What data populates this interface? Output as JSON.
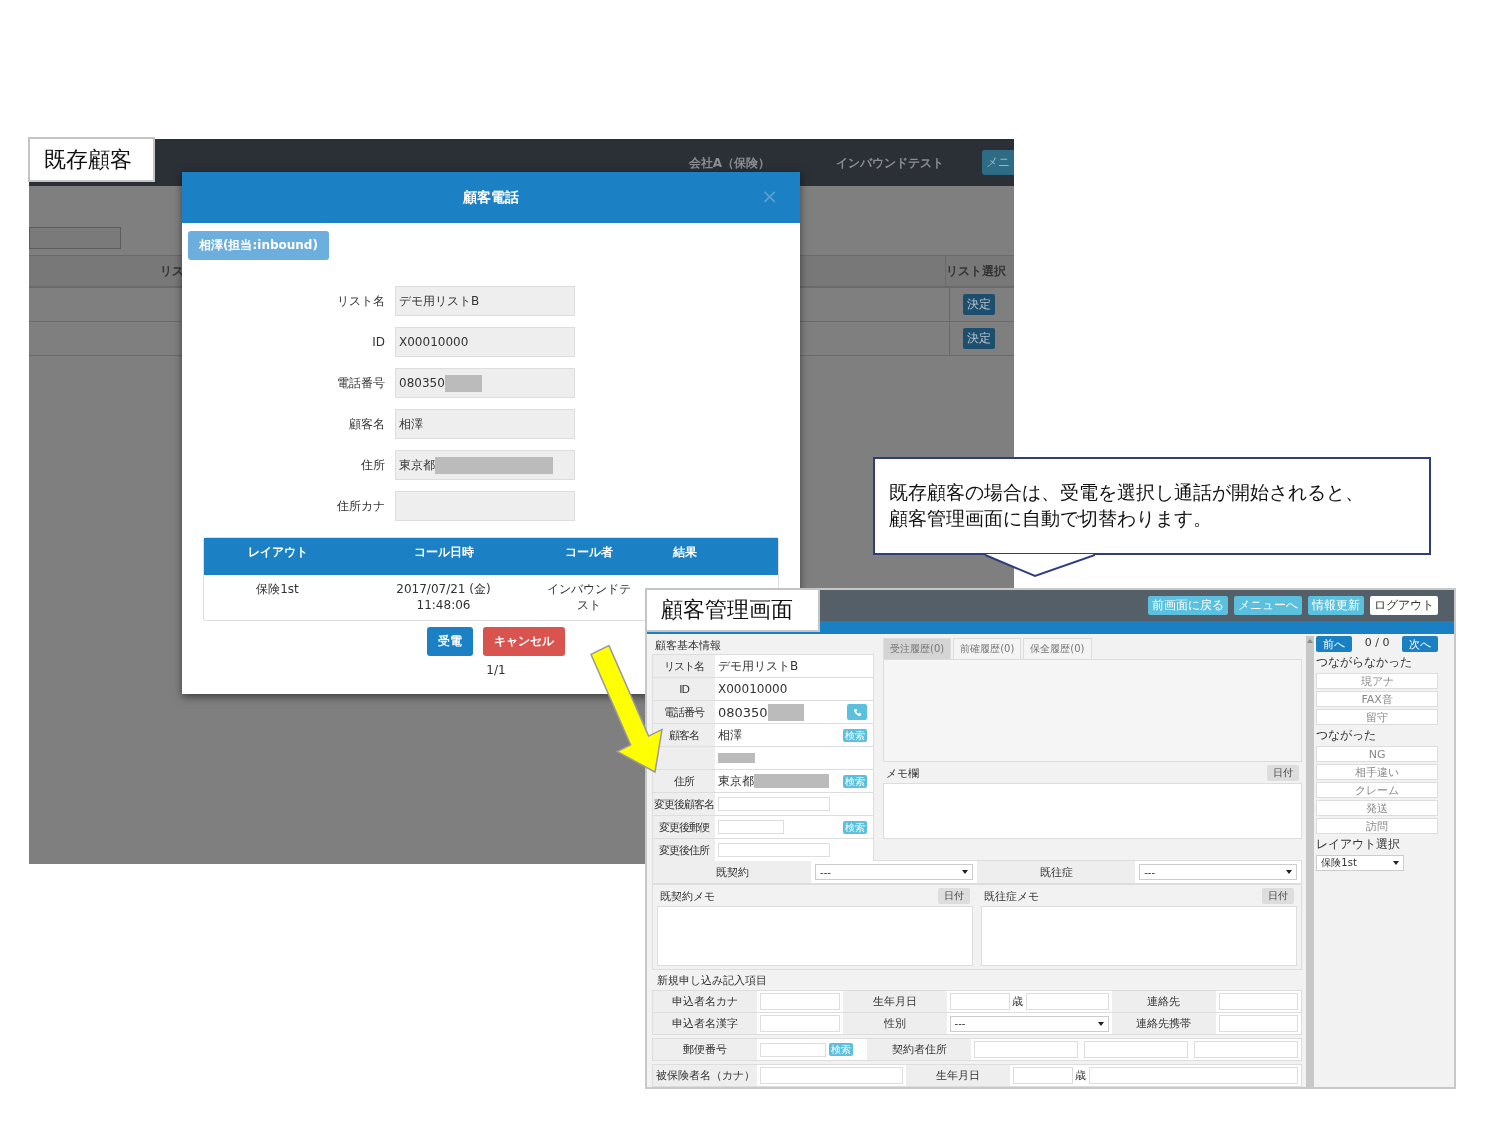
{
  "existing_customer_screen": {
    "caption": "既存顧客",
    "header": {
      "company": "会社A（保険）",
      "campaign": "インバウンドテスト",
      "menu_button": "メニ"
    },
    "list_table": {
      "column_1": "リス",
      "column_2": "リスト選択",
      "rows": [
        {
          "action": "決定"
        },
        {
          "action": "決定"
        }
      ]
    },
    "dialog": {
      "title": "顧客電話",
      "close": "×",
      "customer_badge": "相澤(担当:inbound)",
      "fields": [
        {
          "label": "リスト名",
          "value": "デモ用リストB",
          "masked": false
        },
        {
          "label": "ID",
          "value": "X00010000",
          "masked": false
        },
        {
          "label": "電話番号",
          "value": "080350",
          "masked": true
        },
        {
          "label": "顧客名",
          "value": "相澤",
          "masked": false
        },
        {
          "label": "住所",
          "value": "東京都",
          "masked": true
        },
        {
          "label": "住所カナ",
          "masked": false
        }
      ],
      "history": {
        "columns": [
          "レイアウト",
          "コール日時",
          "コール者",
          "結果"
        ],
        "rows": [
          {
            "layout": "保険1st",
            "call_datetime": "2017/07/21 (金) 11:48:06",
            "caller": "インバウンドテスト"
          }
        ]
      },
      "buttons": [
        {
          "label": "受電",
          "kind": "primary"
        },
        {
          "label": "キャンセル",
          "kind": "danger"
        }
      ],
      "pager": "1/1"
    }
  },
  "callout": {
    "lines": [
      "既存顧客の場合は、受電を選択し通話が開始されると、",
      "顧客管理画面に自動で切替わります。"
    ]
  },
  "customer_management_screen": {
    "caption": "顧客管理画面",
    "header_buttons": [
      {
        "label": "前画面に戻る",
        "kind": "info"
      },
      {
        "label": "メニューへ",
        "kind": "info"
      },
      {
        "label": "情報更新",
        "kind": "info"
      },
      {
        "label": "ログアウト",
        "kind": "light"
      }
    ],
    "basic_info": {
      "title": "顧客基本情報",
      "rows": [
        {
          "label": "リスト名",
          "kind": "text",
          "value": "デモ用リストB",
          "masked": false
        },
        {
          "label": "ID",
          "kind": "text",
          "value": "X00010000",
          "masked": false
        },
        {
          "label": "電話番号",
          "kind": "phone",
          "value": "080350",
          "masked": true
        },
        {
          "label": "顧客名",
          "kind": "search",
          "value": "相澤",
          "masked": false,
          "button": "検索"
        },
        {
          "kind": "text",
          "masked": true
        },
        {
          "label": "住所",
          "kind": "search",
          "value": "東京都",
          "masked": true,
          "button": "検索"
        },
        {
          "label": "変更後顧客名",
          "kind": "input",
          "masked": false
        },
        {
          "label": "変更後郵便",
          "kind": "input_search",
          "masked": false,
          "button": "検索"
        },
        {
          "label": "変更後住所",
          "kind": "input",
          "masked": false
        }
      ]
    },
    "history_tabs": [
      {
        "label": "受注履歴(0)",
        "selected": true
      },
      {
        "label": "前確履歴(0)",
        "selected": false
      },
      {
        "label": "保全履歴(0)",
        "selected": false
      }
    ],
    "memo": {
      "title": "メモ欄",
      "date_button": "日付"
    },
    "side_panel": {
      "prev": "前へ",
      "counter": "0 / 0",
      "next": "次へ",
      "groups": [
        {
          "title": "つながらなかった",
          "buttons": [
            "現アナ",
            "FAX音",
            "留守"
          ]
        },
        {
          "title": "つながった",
          "buttons": [
            "NG",
            "相手違い",
            "クレーム",
            "発送",
            "訪問"
          ]
        }
      ],
      "layout_label": "レイアウト選択",
      "layout_value": "保険1st"
    },
    "history_selects": [
      {
        "label": "既契約",
        "value": "---"
      },
      {
        "label": "既往症",
        "value": "---"
      }
    ],
    "memos": [
      {
        "title": "既契約メモ",
        "date_button": "日付"
      },
      {
        "title": "既往症メモ",
        "date_button": "日付"
      }
    ],
    "application": {
      "title": "新規申し込み記入項目",
      "sections": [
        {
          "rows": [
            [
              {
                "kind": "label",
                "text": "申込者名カナ"
              },
              {
                "kind": "input"
              },
              {
                "kind": "label",
                "text": "生年月日"
              },
              {
                "kind": "age",
                "text": "歳"
              },
              {
                "kind": "label",
                "text": "連絡先"
              },
              {
                "kind": "input"
              }
            ],
            [
              {
                "kind": "label",
                "text": "申込者名漢字"
              },
              {
                "kind": "input"
              },
              {
                "kind": "label",
                "text": "性別"
              },
              {
                "kind": "select",
                "text": "---"
              },
              {
                "kind": "label",
                "text": "連絡先携帯"
              },
              {
                "kind": "input"
              }
            ]
          ]
        },
        {
          "rows": [
            [
              {
                "kind": "label",
                "text": "郵便番号"
              },
              {
                "kind": "input_search",
                "text": "検索"
              },
              {
                "kind": "label",
                "text": "契約者住所"
              },
              {
                "kind": "input"
              },
              {
                "kind": "input"
              },
              {
                "kind": "input"
              }
            ]
          ]
        },
        {
          "rows": [
            [
              {
                "kind": "label",
                "text": "被保険者名（カナ）"
              },
              {
                "kind": "input"
              },
              {
                "kind": "label",
                "text": "生年月日"
              },
              {
                "kind": "age",
                "text": "歳"
              }
            ]
          ]
        }
      ]
    }
  }
}
